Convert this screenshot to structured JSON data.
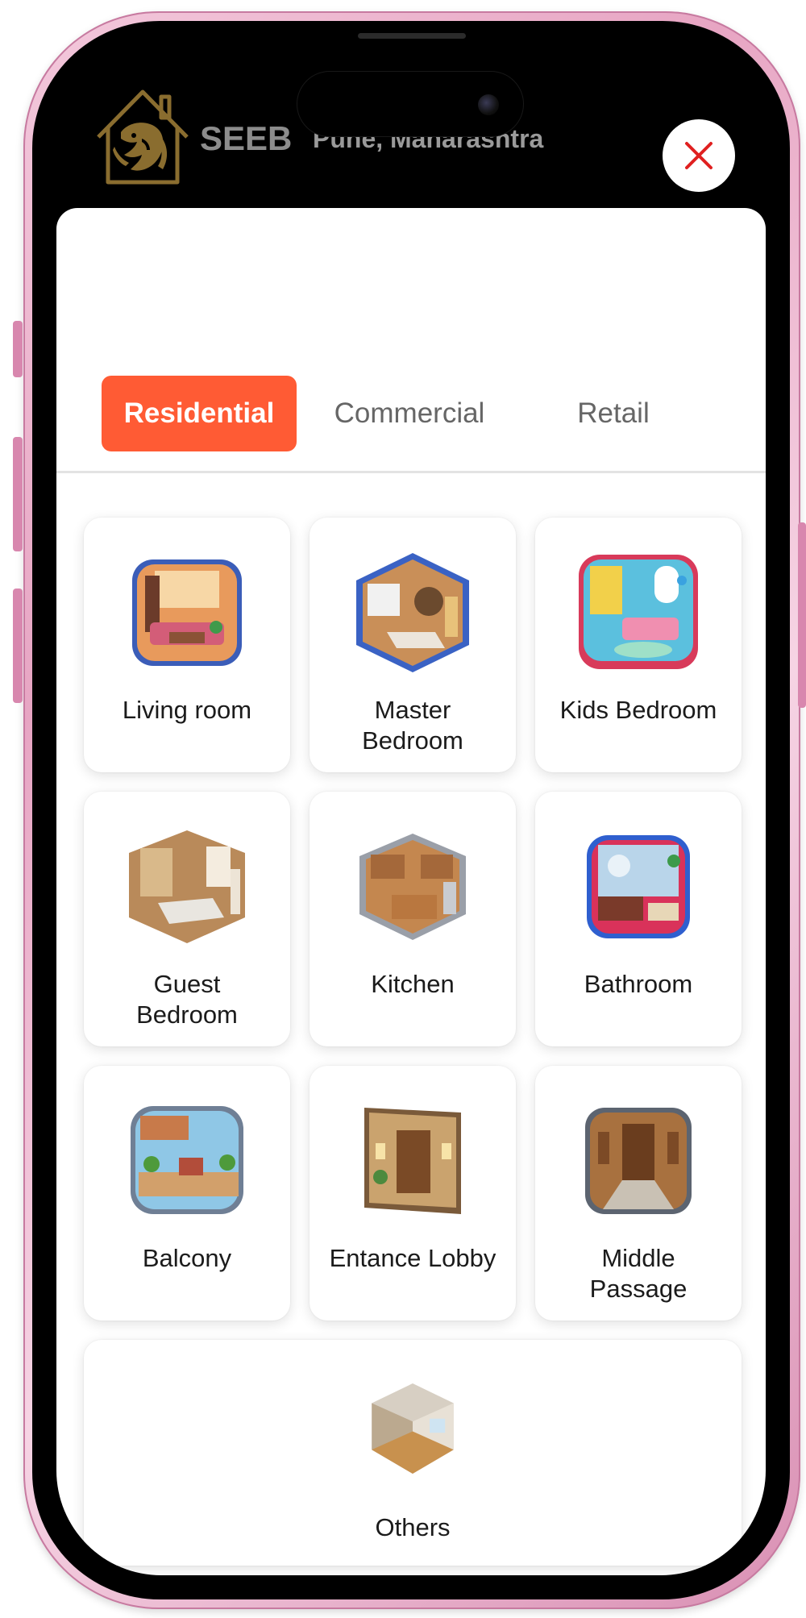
{
  "header": {
    "brand": "SEEB",
    "location": "Pune, Maharashtra"
  },
  "tabs": [
    {
      "label": "Residential",
      "active": true
    },
    {
      "label": "Commercial",
      "active": false
    },
    {
      "label": "Retail",
      "active": false
    }
  ],
  "rooms": [
    {
      "label": "Living room",
      "icon": "living-room-icon"
    },
    {
      "label": "Master\nBedroom",
      "icon": "master-bedroom-icon"
    },
    {
      "label": "Kids Bedroom",
      "icon": "kids-bedroom-icon"
    },
    {
      "label": "Guest\nBedroom",
      "icon": "guest-bedroom-icon"
    },
    {
      "label": "Kitchen",
      "icon": "kitchen-icon"
    },
    {
      "label": "Bathroom",
      "icon": "bathroom-icon"
    },
    {
      "label": "Balcony",
      "icon": "balcony-icon"
    },
    {
      "label": "Entance Lobby",
      "icon": "entrance-lobby-icon"
    },
    {
      "label": "Middle\nPassage",
      "icon": "middle-passage-icon"
    },
    {
      "label": "Others",
      "icon": "others-room-icon"
    }
  ],
  "colors": {
    "accent": "#ff5b34",
    "close_icon": "#e02020",
    "logo_gold": "#8a6d2f",
    "phone_frame": "#e7a5c3"
  }
}
